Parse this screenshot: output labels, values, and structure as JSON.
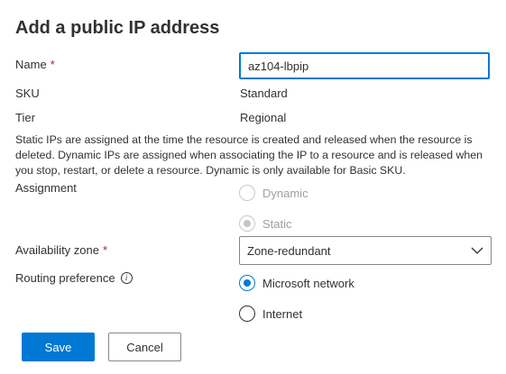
{
  "panel": {
    "title": "Add a public IP address"
  },
  "form": {
    "name": {
      "label": "Name",
      "required_mark": "*",
      "value": "az104-lbpip"
    },
    "sku": {
      "label": "SKU",
      "value": "Standard"
    },
    "tier": {
      "label": "Tier",
      "value": "Regional"
    },
    "description": "Static IPs are assigned at the time the resource is created and released when the resource is deleted. Dynamic IPs are assigned when associating the IP to a resource and is released when you stop, restart, or delete a resource. Dynamic is only available for Basic SKU.",
    "assignment": {
      "label": "Assignment",
      "options": [
        {
          "label": "Dynamic",
          "checked": false,
          "disabled": true
        },
        {
          "label": "Static",
          "checked": true,
          "disabled": true
        }
      ]
    },
    "availability_zone": {
      "label": "Availability zone",
      "required_mark": "*",
      "selected": "Zone-redundant"
    },
    "routing_preference": {
      "label": "Routing preference",
      "options": [
        {
          "label": "Microsoft network",
          "checked": true,
          "disabled": false
        },
        {
          "label": "Internet",
          "checked": false,
          "disabled": false
        }
      ]
    }
  },
  "buttons": {
    "save": "Save",
    "cancel": "Cancel"
  },
  "colors": {
    "accent": "#0078d4",
    "required": "#a4262c",
    "disabled": "#a19f9d"
  },
  "icons": {
    "info": "info-icon",
    "dropdown": "chevron-down-icon"
  }
}
